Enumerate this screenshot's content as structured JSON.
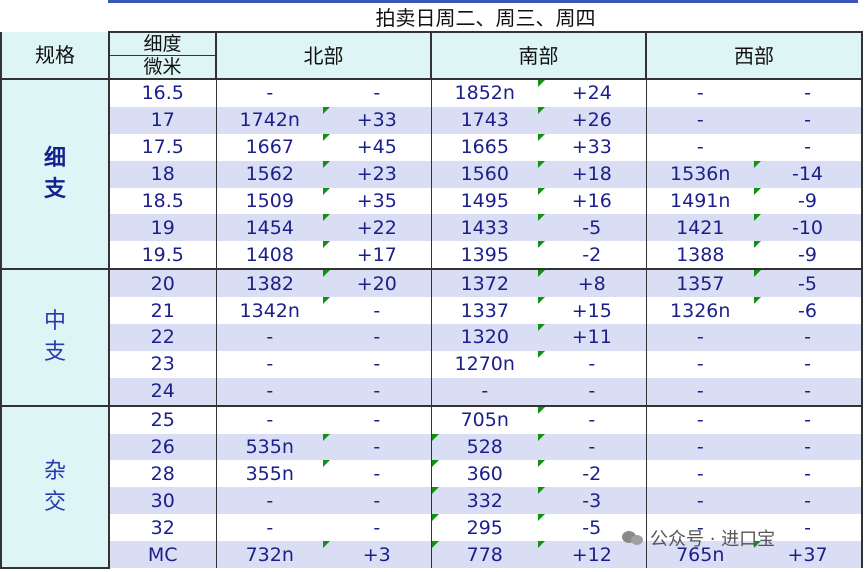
{
  "title": "拍卖日周二、周三、周四",
  "headers": {
    "spec": "规格",
    "fineness_top": "细度",
    "fineness_bottom": "微米",
    "regions": [
      "北部",
      "南部",
      "西部"
    ]
  },
  "groups": [
    {
      "label": "细\n支",
      "bold": true,
      "rows": [
        {
          "size": "16.5",
          "n": [
            "-",
            "-"
          ],
          "s": [
            "1852n",
            "+24"
          ],
          "w": [
            "-",
            "-"
          ]
        },
        {
          "size": "17",
          "n": [
            "1742n",
            "+33"
          ],
          "s": [
            "1743",
            "+26"
          ],
          "w": [
            "-",
            "-"
          ]
        },
        {
          "size": "17.5",
          "n": [
            "1667",
            "+45"
          ],
          "s": [
            "1665",
            "+33"
          ],
          "w": [
            "-",
            "-"
          ]
        },
        {
          "size": "18",
          "n": [
            "1562",
            "+23"
          ],
          "s": [
            "1560",
            "+18"
          ],
          "w": [
            "1536n",
            "-14"
          ]
        },
        {
          "size": "18.5",
          "n": [
            "1509",
            "+35"
          ],
          "s": [
            "1495",
            "+16"
          ],
          "w": [
            "1491n",
            "-9"
          ]
        },
        {
          "size": "19",
          "n": [
            "1454",
            "+22"
          ],
          "s": [
            "1433",
            "-5"
          ],
          "w": [
            "1421",
            "-10"
          ]
        },
        {
          "size": "19.5",
          "n": [
            "1408",
            "+17"
          ],
          "s": [
            "1395",
            "-2"
          ],
          "w": [
            "1388",
            "-9"
          ]
        }
      ]
    },
    {
      "label": "中\n支",
      "bold": false,
      "rows": [
        {
          "size": "20",
          "n": [
            "1382",
            "+20"
          ],
          "s": [
            "1372",
            "+8"
          ],
          "w": [
            "1357",
            "-5"
          ]
        },
        {
          "size": "21",
          "n": [
            "1342n",
            "-"
          ],
          "s": [
            "1337",
            "+15"
          ],
          "w": [
            "1326n",
            "-6"
          ]
        },
        {
          "size": "22",
          "n": [
            "-",
            "-"
          ],
          "s": [
            "1320",
            "+11"
          ],
          "w": [
            "-",
            "-"
          ]
        },
        {
          "size": "23",
          "n": [
            "-",
            "-"
          ],
          "s": [
            "1270n",
            "-"
          ],
          "w": [
            "-",
            "-"
          ]
        },
        {
          "size": "24",
          "n": [
            "-",
            "-"
          ],
          "s": [
            "-",
            "-"
          ],
          "w": [
            "-",
            "-"
          ]
        }
      ]
    },
    {
      "label": "杂\n交",
      "bold": false,
      "rows": [
        {
          "size": "25",
          "n": [
            "-",
            "-"
          ],
          "s": [
            "705n",
            "-"
          ],
          "w": [
            "-",
            "-"
          ]
        },
        {
          "size": "26",
          "n": [
            "535n",
            "-"
          ],
          "s": [
            "528",
            "-"
          ],
          "w": [
            "-",
            "-"
          ]
        },
        {
          "size": "28",
          "n": [
            "355n",
            "-"
          ],
          "s": [
            "360",
            "-2"
          ],
          "w": [
            "-",
            "-"
          ]
        },
        {
          "size": "30",
          "n": [
            "-",
            "-"
          ],
          "s": [
            "332",
            "-3"
          ],
          "w": [
            "-",
            "-"
          ]
        },
        {
          "size": "32",
          "n": [
            "-",
            "-"
          ],
          "s": [
            "295",
            "-5"
          ],
          "w": [
            "-",
            "-"
          ]
        },
        {
          "size": "MC",
          "n": [
            "732n",
            "+3"
          ],
          "s": [
            "778",
            "+12"
          ],
          "w": [
            "765n",
            "+37"
          ]
        }
      ]
    }
  ],
  "watermark": "公众号 · 进口宝"
}
